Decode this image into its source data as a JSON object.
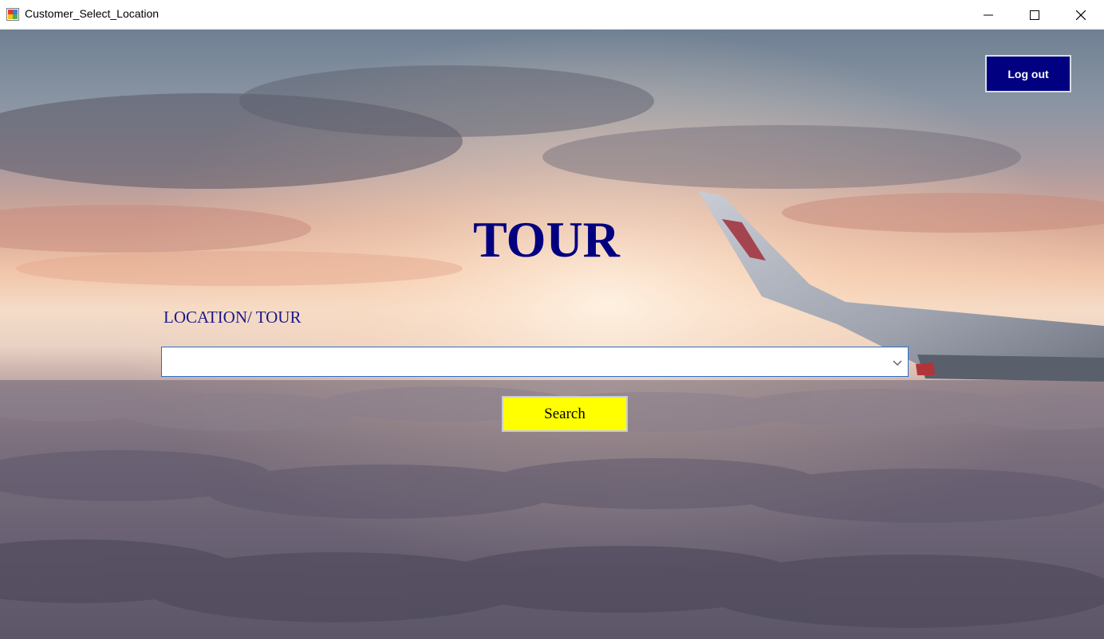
{
  "window": {
    "title": "Customer_Select_Location"
  },
  "header": {
    "logout_label": "Log out"
  },
  "main": {
    "title": "TOUR",
    "location_label": "LOCATION/ TOUR",
    "location_select": {
      "value": ""
    },
    "search_label": "Search"
  },
  "icons": {
    "app": "app-icon",
    "minimize": "minimize-icon",
    "maximize": "maximize-icon",
    "close": "close-icon",
    "dropdown": "chevron-down-icon"
  },
  "colors": {
    "title_navy": "#000080",
    "logout_bg": "#000080",
    "search_bg": "#ffff00",
    "select_border": "#2a6fc9"
  }
}
